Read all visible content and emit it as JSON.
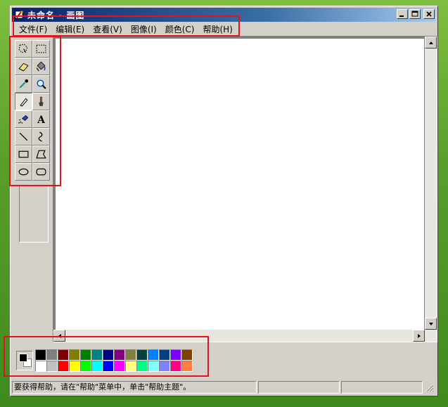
{
  "window": {
    "title": "未命名 - 画图"
  },
  "menu": [
    {
      "label": "文件(F)"
    },
    {
      "label": "编辑(E)"
    },
    {
      "label": "查看(V)"
    },
    {
      "label": "图像(I)"
    },
    {
      "label": "颜色(C)"
    },
    {
      "label": "帮助(H)"
    }
  ],
  "tools": [
    {
      "name": "free-select-icon"
    },
    {
      "name": "rect-select-icon"
    },
    {
      "name": "eraser-icon"
    },
    {
      "name": "fill-bucket-icon"
    },
    {
      "name": "color-picker-icon"
    },
    {
      "name": "magnifier-icon"
    },
    {
      "name": "pencil-icon",
      "active": true
    },
    {
      "name": "brush-icon"
    },
    {
      "name": "airbrush-icon"
    },
    {
      "name": "text-icon"
    },
    {
      "name": "line-icon"
    },
    {
      "name": "curve-icon"
    },
    {
      "name": "rectangle-icon"
    },
    {
      "name": "polygon-icon"
    },
    {
      "name": "ellipse-icon"
    },
    {
      "name": "rounded-rect-icon"
    }
  ],
  "palette": {
    "foreground": "#000000",
    "background": "#ffffff",
    "row1": [
      "#000000",
      "#808080",
      "#800000",
      "#808000",
      "#008000",
      "#008080",
      "#000080",
      "#800080",
      "#808040",
      "#004040",
      "#0080ff",
      "#004080",
      "#8000ff",
      "#804000"
    ],
    "row2": [
      "#ffffff",
      "#c0c0c0",
      "#ff0000",
      "#ffff00",
      "#00ff00",
      "#00ffff",
      "#0000ff",
      "#ff00ff",
      "#ffff80",
      "#00ff80",
      "#80ffff",
      "#8080ff",
      "#ff0080",
      "#ff8040"
    ]
  },
  "status": {
    "text": "要获得帮助，请在\"帮助\"菜单中，单击\"帮助主题\"。"
  }
}
